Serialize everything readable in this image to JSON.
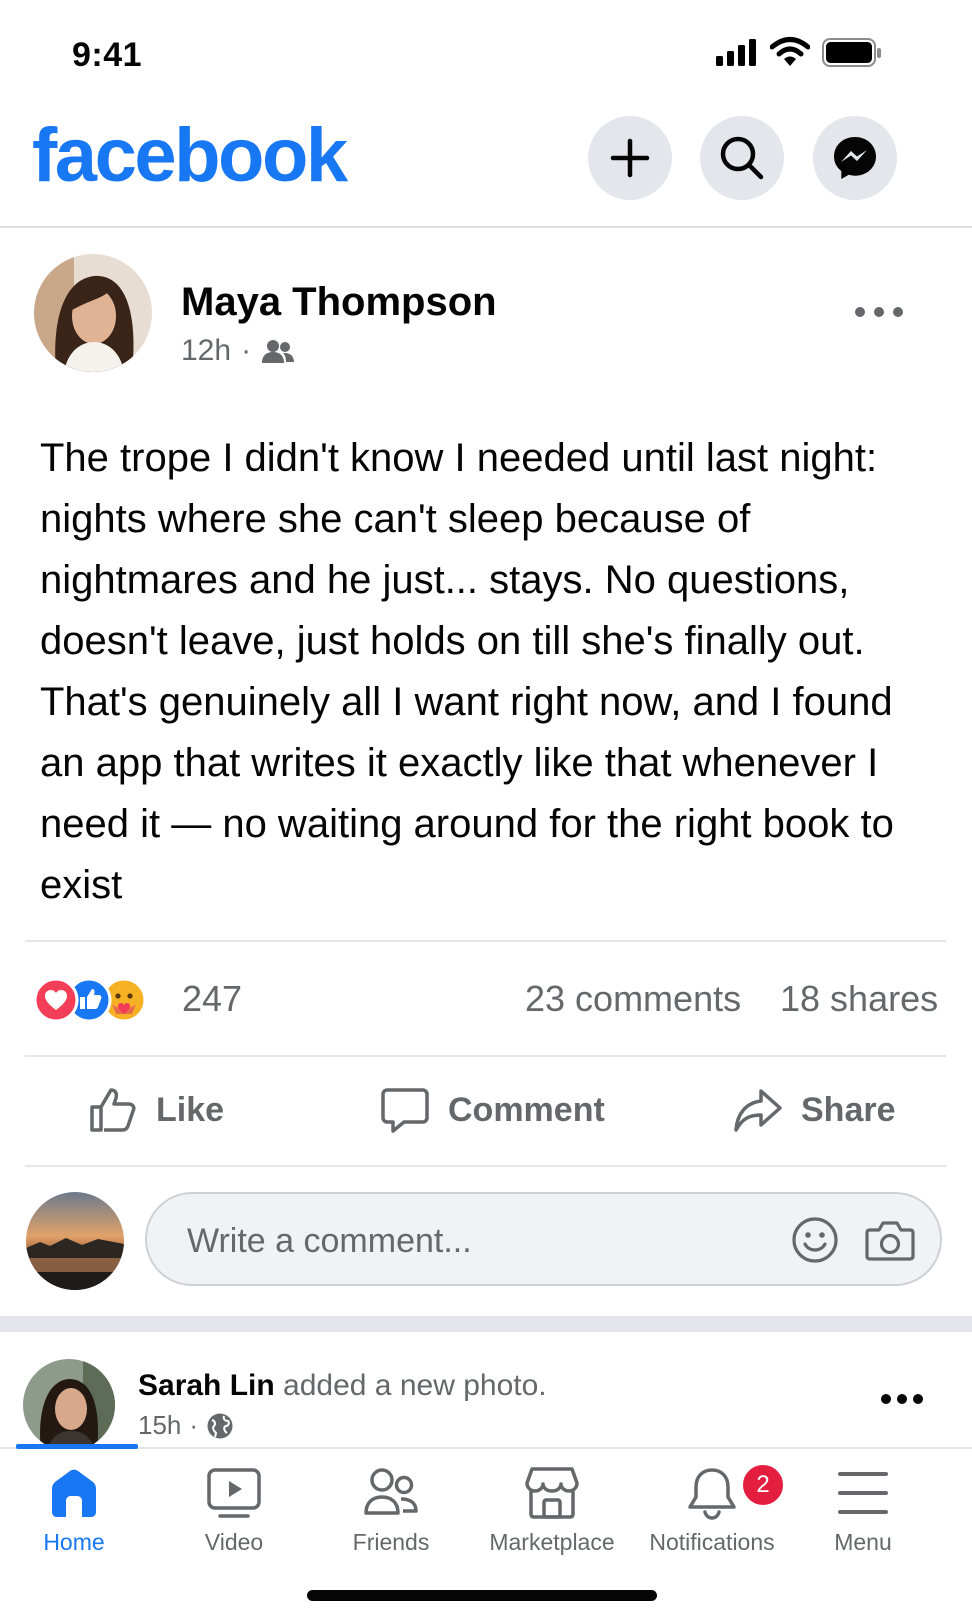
{
  "status_bar": {
    "time": "9:41"
  },
  "header": {
    "logo": "facebook",
    "buttons": [
      "plus-icon",
      "search-icon",
      "messenger-icon"
    ]
  },
  "post": {
    "author": "Maya Thompson",
    "time": "12h",
    "audience_icon": "friends-icon",
    "text": "The trope I didn't know I needed until last night: nights where she can't sleep because of nightmares and he just... stays. No questions, doesn't leave, just holds on till she's finally out. That's genuinely all I want right now, and I found an app that writes it exactly like that whenever I need it — no waiting around for the right book to exist",
    "reactions": {
      "count": "247",
      "icons": [
        "love",
        "like",
        "care"
      ]
    },
    "comments": "23 comments",
    "shares": "18 shares",
    "actions": {
      "like": "Like",
      "comment": "Comment",
      "share": "Share"
    },
    "comment_placeholder": "Write a comment..."
  },
  "next_post": {
    "author": "Sarah Lin",
    "action": "added a new photo.",
    "time": "15h",
    "audience_icon": "globe-icon"
  },
  "tab_bar": {
    "tabs": [
      {
        "label": "Home",
        "icon": "home-icon",
        "active": true
      },
      {
        "label": "Video",
        "icon": "video-icon"
      },
      {
        "label": "Friends",
        "icon": "friends-icon"
      },
      {
        "label": "Marketplace",
        "icon": "marketplace-icon"
      },
      {
        "label": "Notifications",
        "icon": "bell-icon",
        "badge": "2"
      },
      {
        "label": "Menu",
        "icon": "menu-icon"
      }
    ]
  },
  "colors": {
    "brand": "#1877f2",
    "secondary_text": "#65676b",
    "badge": "#e41e3f"
  }
}
